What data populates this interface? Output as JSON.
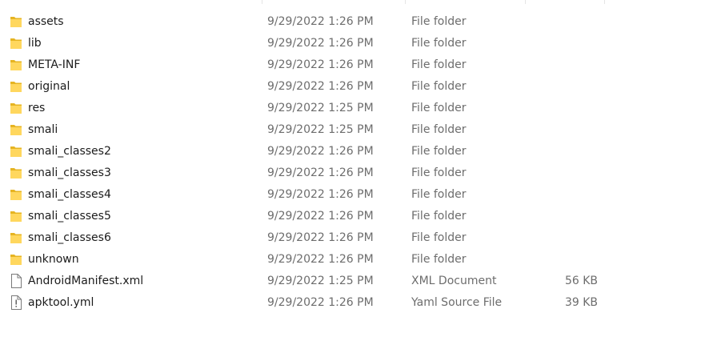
{
  "files": [
    {
      "name": "assets",
      "date": "9/29/2022 1:26 PM",
      "type": "File folder",
      "size": "",
      "icon": "folder-icon"
    },
    {
      "name": "lib",
      "date": "9/29/2022 1:26 PM",
      "type": "File folder",
      "size": "",
      "icon": "folder-icon"
    },
    {
      "name": "META-INF",
      "date": "9/29/2022 1:26 PM",
      "type": "File folder",
      "size": "",
      "icon": "folder-icon"
    },
    {
      "name": "original",
      "date": "9/29/2022 1:26 PM",
      "type": "File folder",
      "size": "",
      "icon": "folder-icon"
    },
    {
      "name": "res",
      "date": "9/29/2022 1:25 PM",
      "type": "File folder",
      "size": "",
      "icon": "folder-icon"
    },
    {
      "name": "smali",
      "date": "9/29/2022 1:25 PM",
      "type": "File folder",
      "size": "",
      "icon": "folder-icon"
    },
    {
      "name": "smali_classes2",
      "date": "9/29/2022 1:26 PM",
      "type": "File folder",
      "size": "",
      "icon": "folder-icon"
    },
    {
      "name": "smali_classes3",
      "date": "9/29/2022 1:26 PM",
      "type": "File folder",
      "size": "",
      "icon": "folder-icon"
    },
    {
      "name": "smali_classes4",
      "date": "9/29/2022 1:26 PM",
      "type": "File folder",
      "size": "",
      "icon": "folder-icon"
    },
    {
      "name": "smali_classes5",
      "date": "9/29/2022 1:26 PM",
      "type": "File folder",
      "size": "",
      "icon": "folder-icon"
    },
    {
      "name": "smali_classes6",
      "date": "9/29/2022 1:26 PM",
      "type": "File folder",
      "size": "",
      "icon": "folder-icon"
    },
    {
      "name": "unknown",
      "date": "9/29/2022 1:26 PM",
      "type": "File folder",
      "size": "",
      "icon": "folder-icon"
    },
    {
      "name": "AndroidManifest.xml",
      "date": "9/29/2022 1:25 PM",
      "type": "XML Document",
      "size": "56 KB",
      "icon": "document-icon"
    },
    {
      "name": "apktool.yml",
      "date": "9/29/2022 1:26 PM",
      "type": "Yaml Source File",
      "size": "39 KB",
      "icon": "yaml-file-icon"
    }
  ],
  "colors": {
    "folder_back": "#e6b422",
    "folder_front": "#ffd75e",
    "name_text": "#1b1b1b",
    "detail_text": "#6d6d6d"
  }
}
